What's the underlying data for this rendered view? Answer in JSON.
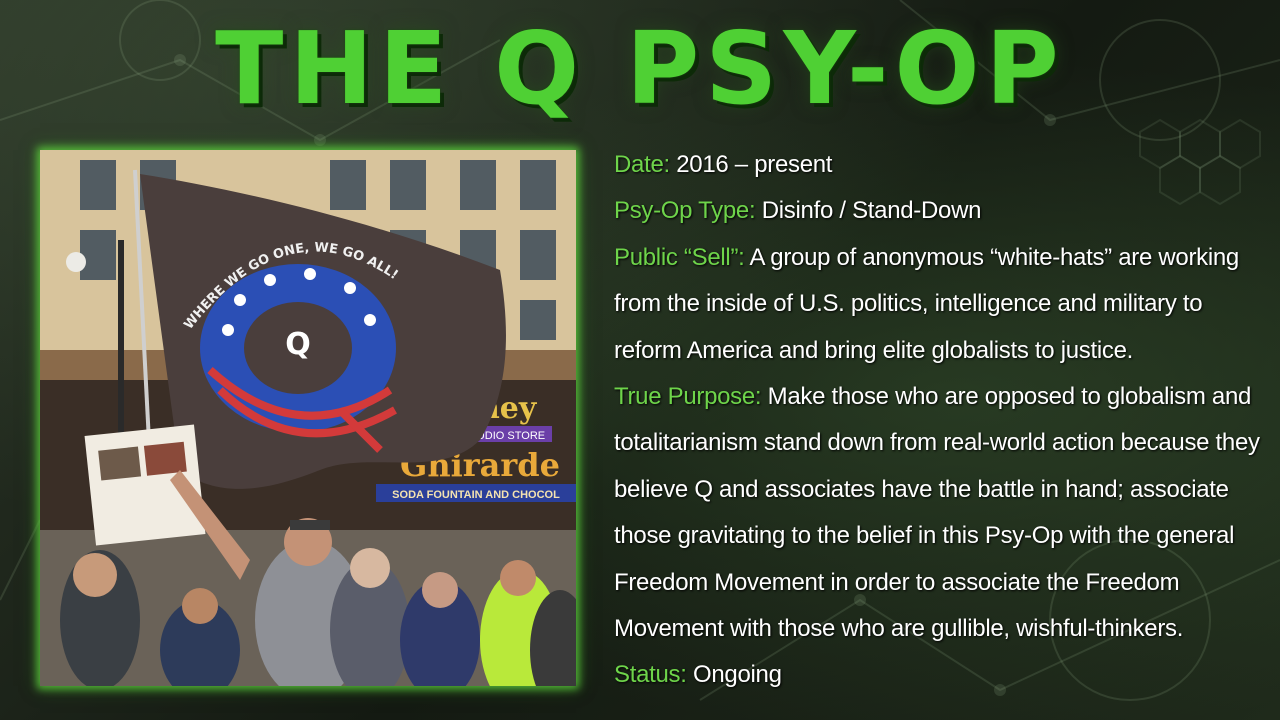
{
  "title": "THE Q PSY-OP",
  "photo": {
    "flag_text": "WHERE WE GO ONE, WE GO ALL!",
    "flag_letter": "Q",
    "storefront_sign": "Disney",
    "storefront_sub": "UDIO STORE",
    "storefront_marquee": "Ghirarde",
    "storefront_banner": "SODA FOUNTAIN AND CHOCOL"
  },
  "info": {
    "date_label": "Date:",
    "date_value": " 2016 – present",
    "type_label": "Psy-Op Type:",
    "type_value": " Disinfo / Stand-Down",
    "sell_label": "Public “Sell”:",
    "sell_lines": [
      " A group of anonymous “white-hats” are working",
      "from the inside of U.S. politics, intelligence and military to",
      "reform America and bring elite globalists to justice."
    ],
    "purpose_label": "True Purpose:",
    "purpose_lines": [
      " Make those who are opposed to globalism and",
      "totalitarianism stand down from real-world action because they",
      "believe Q and associates have the battle in hand; associate",
      "those gravitating to the belief in this Psy-Op with the general",
      "Freedom Movement in order to associate the Freedom",
      "Movement with those who are gullible, wishful-thinkers."
    ],
    "status_label": "Status:",
    "status_value": " Ongoing"
  },
  "colors": {
    "title_green": "#4fd034",
    "label_green": "#6ed44a",
    "body_text": "#ffffff",
    "frame_glow": "#5ac83c"
  }
}
